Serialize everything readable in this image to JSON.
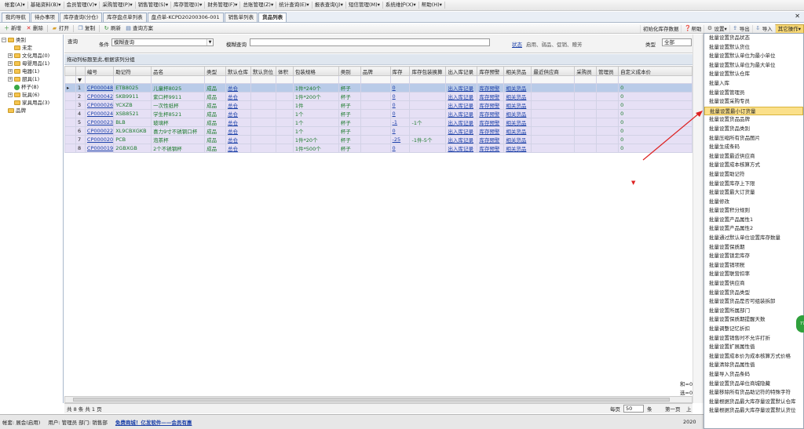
{
  "menubar": {
    "items": [
      "帐套(A)▾",
      "基础资料(B)▾",
      "会员管理(V)▾",
      "采购管理(P)▾",
      "销售管理(S)▾",
      "库存管理(I)▾",
      "财务管理(F)▾",
      "总账管理(Z)▾",
      "统计查询(E)▾",
      "报表查询(J)▾",
      "短信管理(M)▾",
      "系统维护(X)▾",
      "帮助(H)▾"
    ]
  },
  "tabs": [
    "我的导航",
    "待办事项",
    "库存查询(分仓)",
    "库存盘点单列表",
    "盘点单-KCPD20200306-001",
    "销售单列表",
    "货品列表"
  ],
  "active_tab": 6,
  "toolbar": {
    "new": "新增",
    "delete": "删除",
    "open": "打开",
    "copy": "复制",
    "refresh": "刷新",
    "query_plan": "查询方案",
    "right": {
      "init_stock": "初始化库存数据",
      "help": "帮助",
      "settings": "设置▾",
      "export": "导出",
      "import": "导入",
      "other": "其它操作▾"
    }
  },
  "tree": {
    "root": "类别",
    "items": [
      {
        "label": "未定",
        "indent": 1,
        "exp": "",
        "kind": "folder"
      },
      {
        "label": "文化用品(0)",
        "indent": 1,
        "exp": "+",
        "kind": "folder"
      },
      {
        "label": "母婴用品(1)",
        "indent": 1,
        "exp": "+",
        "kind": "folder"
      },
      {
        "label": "电器(1)",
        "indent": 1,
        "exp": "+",
        "kind": "folder"
      },
      {
        "label": "厨具(1)",
        "indent": 1,
        "exp": "+",
        "kind": "folder"
      },
      {
        "label": "杯子(8)",
        "indent": 1,
        "exp": "",
        "kind": "green"
      },
      {
        "label": "玩具(6)",
        "indent": 1,
        "exp": "+",
        "kind": "folder"
      },
      {
        "label": "家具用品(3)",
        "indent": 1,
        "exp": "",
        "kind": "folder"
      },
      {
        "label": "品牌",
        "indent": 0,
        "exp": "",
        "kind": "folder"
      }
    ]
  },
  "filter": {
    "query_label": "查询",
    "condition_label": "条件",
    "condition_value": "模糊查询",
    "fuzzy_label": "模糊查询",
    "status_link": "状态",
    "status_hint": "启用、弱品、促销、赠芳",
    "category_label": "类型",
    "category_value": "全部"
  },
  "group_hint": "拖动列标题至此,根据该列分组",
  "grid": {
    "columns": [
      "",
      "",
      "编号",
      "助记符",
      "品名",
      "类型",
      "默认仓库",
      "默认货位",
      "体积",
      "包装规格",
      "类别",
      "品牌",
      "库存",
      "库存包装换算",
      "出入库记录",
      "库存预警",
      "相关货品",
      "最近供应商",
      "采购员",
      "管理员",
      "自定义成本价"
    ],
    "rows": [
      {
        "n": "1",
        "code": "CP000048",
        "mnem": "ETB8025",
        "name": "儿童杯8025",
        "type": "成品",
        "wh": "总仓",
        "pack": "1件*240个",
        "cat": "杯子",
        "stock": "0",
        "conv": "",
        "sel": true
      },
      {
        "n": "2",
        "code": "CP000042",
        "mnem": "SKB9911",
        "name": "紫口杯9911",
        "type": "成品",
        "wh": "总仓",
        "pack": "1件*200个",
        "cat": "杯子",
        "stock": "0",
        "conv": "",
        "sel": false
      },
      {
        "n": "3",
        "code": "CP000026",
        "mnem": "YCXZB",
        "name": "一次性纸杯",
        "type": "成品",
        "wh": "总仓",
        "pack": "1件",
        "cat": "杯子",
        "stock": "0",
        "conv": "",
        "sel": false
      },
      {
        "n": "4",
        "code": "CP000024",
        "mnem": "XSB8521",
        "name": "学生杯8521",
        "type": "成品",
        "wh": "总仓",
        "pack": "1个",
        "cat": "杯子",
        "stock": "0",
        "conv": "",
        "sel": false
      },
      {
        "n": "5",
        "code": "CP000023",
        "mnem": "BLB",
        "name": "玻璃杯",
        "type": "成品",
        "wh": "总仓",
        "pack": "1个",
        "cat": "杯子",
        "stock": "-1",
        "conv": "-1个",
        "sel": false
      },
      {
        "n": "6",
        "code": "CP000022",
        "mnem": "XL9CBXGKB",
        "name": "喜力9寸不锈钢口杯",
        "type": "成品",
        "wh": "总仓",
        "pack": "1个",
        "cat": "杯子",
        "stock": "0",
        "conv": "",
        "sel": false
      },
      {
        "n": "7",
        "code": "CP000020",
        "mnem": "PCB",
        "name": "泡茶杯",
        "type": "成品",
        "wh": "总仓",
        "pack": "1件*20个",
        "cat": "杯子",
        "stock": "-25",
        "conv": "-1件-5个",
        "sel": false
      },
      {
        "n": "8",
        "code": "CP000019",
        "mnem": "2GBXGB",
        "name": "2个不锈钢杯",
        "type": "成品",
        "wh": "总仓",
        "pack": "1件*500个",
        "cat": "杯子",
        "stock": "0",
        "conv": "",
        "sel": false
      }
    ],
    "link_texts": {
      "inout": "出入库记录",
      "warn": "库存预警",
      "related": "相关货品"
    },
    "cost": "0"
  },
  "summary": {
    "a": "和=0",
    "b": "选=0"
  },
  "pager": {
    "total": "共 8 条  共 1 页",
    "per_page_label": "每页",
    "per_page": "50",
    "unit": "条",
    "first": "第一页",
    "prev": "上"
  },
  "statusbar": {
    "account": "帐套: 展会(启用)",
    "user": "用户: 管理员  部门: 销售部",
    "ad": "免费商城！亿发软件——会员有惠",
    "year": "2020"
  },
  "dropdown": {
    "items": [
      "批量设置货品状态",
      "批量设置默认货位",
      "批量设置默认单位为最小单位",
      "批量设置默认单位为最大单位",
      "批量设置默认仓库",
      "批量入库",
      "批量设置管理员",
      "批量设置采购专员",
      "批量设置最小订货量",
      "批量设置货品品牌",
      "批量设置货品类别",
      "批量压缩所有货品图片",
      "批量生成条码",
      "批量设置最近供应商",
      "批量设置成本核算方式",
      "批量设置助记符",
      "批量设置库存上下限",
      "批量设置最大订货量",
      "批量修改",
      "批量设置积分规则",
      "批量设置产品属性1",
      "批量设置产品属性2",
      "批量通过默认单位设置库存数量",
      "批量设置保质期",
      "批量设置锁定库存",
      "批量设置销项税",
      "批量设置联营扣率",
      "批量设置供应商",
      "批量设置货品类型",
      "批量设置货品是否可组装拆卸",
      "批量设置所属部门",
      "批量设置保质期提醒天数",
      "批量调整记忆折扣",
      "批量设置销售时不允许打折",
      "批量设置扩展属性值",
      "批量设置成本价为成本核算方式价格",
      "批量清除货品属性值",
      "批量导入货品条码",
      "批量设置货品单位商城隐藏",
      "批量移除所有货品助记符的特殊字符",
      "批量根据货品最大库存量设置默认仓库",
      "批量根据货品最大库存量设置默认货位"
    ],
    "highlighted": 8
  },
  "side_badge": "77"
}
